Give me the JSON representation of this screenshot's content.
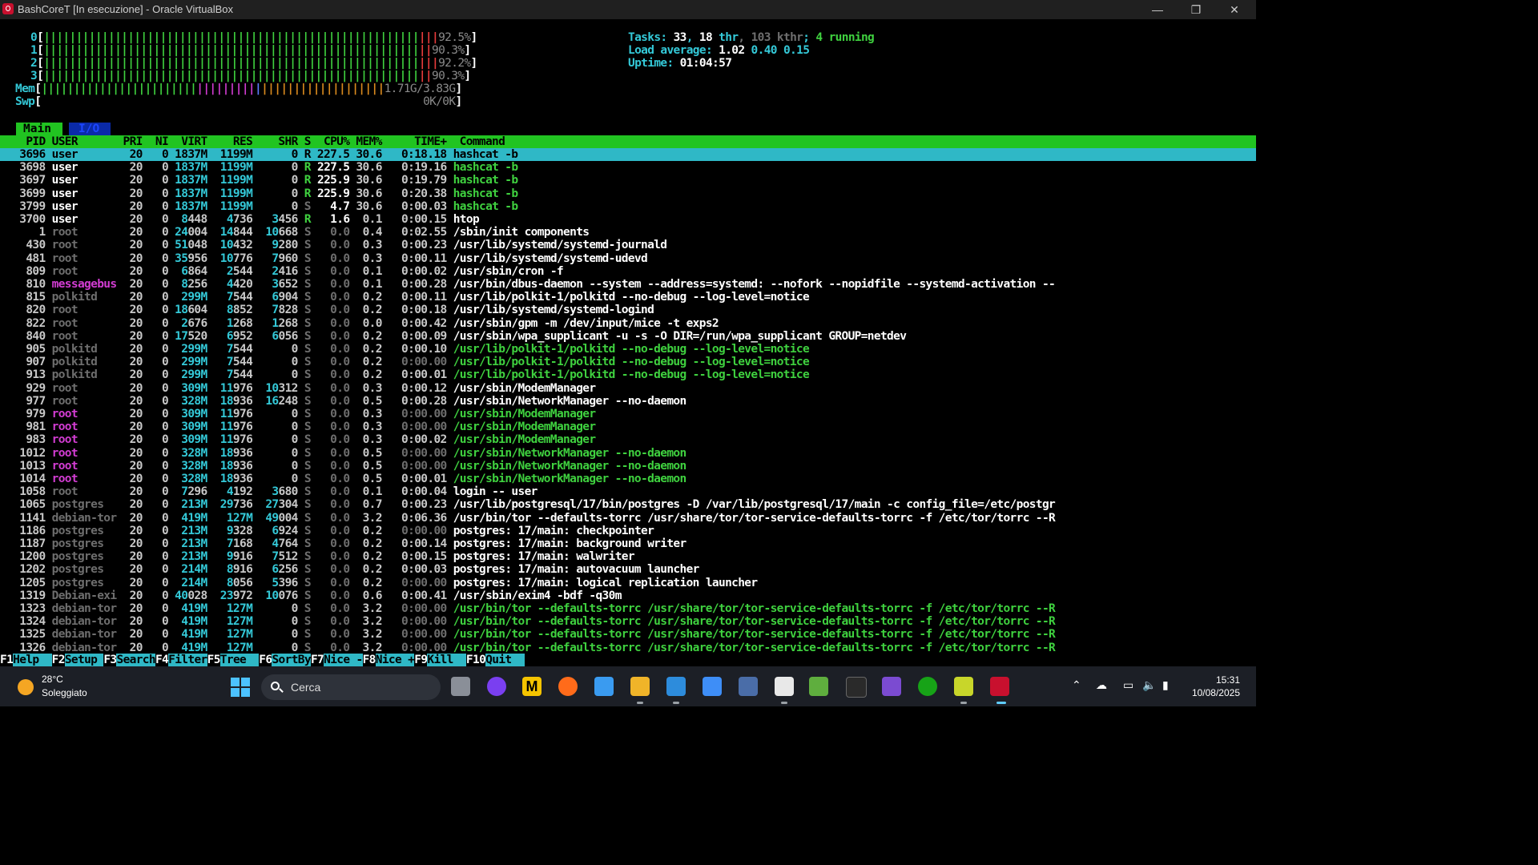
{
  "window": {
    "title": "BashCoreT [In esecuzione] - Oracle VirtualBox",
    "min": "—",
    "max": "❐",
    "close": "✕"
  },
  "meters": {
    "cpu0": "92.5%",
    "cpu1": "90.3%",
    "cpu2": "92.2%",
    "cpu3": "90.3%",
    "mem": "1.71G/3.83G",
    "swp": "0K/0K"
  },
  "stats": {
    "tasks_label": "Tasks: ",
    "tasks": "33",
    "thr": "18",
    "thr_label": " thr",
    "kthr": "103",
    "kthr_label": " kthr",
    "running": "4",
    "running_label": " running",
    "load_label": "Load average: ",
    "load1": "1.02",
    "load5": "0.40",
    "load15": "0.15",
    "uptime_label": "Uptime: ",
    "uptime": "01:04:57"
  },
  "tabs": {
    "main": "Main",
    "io": "I/O"
  },
  "columns": {
    "pid": "PID",
    "user": "USER",
    "pri": "PRI",
    "ni": "NI",
    "virt": "VIRT",
    "res": "RES",
    "shr": "SHR",
    "s": "S",
    "cpu": "CPU%",
    "mem": "MEM%",
    "time": "TIME+",
    "command": "Command"
  },
  "processes": [
    [
      "3696",
      "user",
      "20",
      "0",
      "1837M",
      "1199M",
      "0",
      "R",
      "227.5",
      "30.6",
      "0:18.18",
      "hashcat -b"
    ],
    [
      "3698",
      "user",
      "20",
      "0",
      "1837M",
      "1199M",
      "0",
      "R",
      "227.5",
      "30.6",
      "0:19.16",
      "hashcat -b"
    ],
    [
      "3697",
      "user",
      "20",
      "0",
      "1837M",
      "1199M",
      "0",
      "R",
      "225.9",
      "30.6",
      "0:19.79",
      "hashcat -b"
    ],
    [
      "3699",
      "user",
      "20",
      "0",
      "1837M",
      "1199M",
      "0",
      "R",
      "225.9",
      "30.6",
      "0:20.38",
      "hashcat -b"
    ],
    [
      "3799",
      "user",
      "20",
      "0",
      "1837M",
      "1199M",
      "0",
      "S",
      "4.7",
      "30.6",
      "0:00.03",
      "hashcat -b"
    ],
    [
      "3700",
      "user",
      "20",
      "0",
      "8448",
      "4736",
      "3456",
      "R",
      "1.6",
      "0.1",
      "0:00.15",
      "htop"
    ],
    [
      "1",
      "root",
      "20",
      "0",
      "24004",
      "14844",
      "10668",
      "S",
      "0.0",
      "0.4",
      "0:02.55",
      "/sbin/init components"
    ],
    [
      "430",
      "root",
      "20",
      "0",
      "51048",
      "10432",
      "9280",
      "S",
      "0.0",
      "0.3",
      "0:00.23",
      "/usr/lib/systemd/systemd-journald"
    ],
    [
      "481",
      "root",
      "20",
      "0",
      "35956",
      "10776",
      "7960",
      "S",
      "0.0",
      "0.3",
      "0:00.11",
      "/usr/lib/systemd/systemd-udevd"
    ],
    [
      "809",
      "root",
      "20",
      "0",
      "6864",
      "2544",
      "2416",
      "S",
      "0.0",
      "0.1",
      "0:00.02",
      "/usr/sbin/cron -f"
    ],
    [
      "810",
      "messagebus",
      "20",
      "0",
      "8256",
      "4420",
      "3652",
      "S",
      "0.0",
      "0.1",
      "0:00.28",
      "/usr/bin/dbus-daemon --system --address=systemd: --nofork --nopidfile --systemd-activation --"
    ],
    [
      "815",
      "polkitd",
      "20",
      "0",
      "299M",
      "7544",
      "6904",
      "S",
      "0.0",
      "0.2",
      "0:00.11",
      "/usr/lib/polkit-1/polkitd --no-debug --log-level=notice"
    ],
    [
      "820",
      "root",
      "20",
      "0",
      "18604",
      "8852",
      "7828",
      "S",
      "0.0",
      "0.2",
      "0:00.18",
      "/usr/lib/systemd/systemd-logind"
    ],
    [
      "822",
      "root",
      "20",
      "0",
      "2676",
      "1268",
      "1268",
      "S",
      "0.0",
      "0.0",
      "0:00.42",
      "/usr/sbin/gpm -m /dev/input/mice -t exps2"
    ],
    [
      "840",
      "root",
      "20",
      "0",
      "17520",
      "6952",
      "6056",
      "S",
      "0.0",
      "0.2",
      "0:00.09",
      "/usr/sbin/wpa_supplicant -u -s -O DIR=/run/wpa_supplicant GROUP=netdev"
    ],
    [
      "905",
      "polkitd",
      "20",
      "0",
      "299M",
      "7544",
      "0",
      "S",
      "0.0",
      "0.2",
      "0:00.10",
      "/usr/lib/polkit-1/polkitd --no-debug --log-level=notice"
    ],
    [
      "907",
      "polkitd",
      "20",
      "0",
      "299M",
      "7544",
      "0",
      "S",
      "0.0",
      "0.2",
      "0:00.00",
      "/usr/lib/polkit-1/polkitd --no-debug --log-level=notice"
    ],
    [
      "913",
      "polkitd",
      "20",
      "0",
      "299M",
      "7544",
      "0",
      "S",
      "0.0",
      "0.2",
      "0:00.01",
      "/usr/lib/polkit-1/polkitd --no-debug --log-level=notice"
    ],
    [
      "929",
      "root",
      "20",
      "0",
      "309M",
      "11976",
      "10312",
      "S",
      "0.0",
      "0.3",
      "0:00.12",
      "/usr/sbin/ModemManager"
    ],
    [
      "977",
      "root",
      "20",
      "0",
      "328M",
      "18936",
      "16248",
      "S",
      "0.0",
      "0.5",
      "0:00.28",
      "/usr/sbin/NetworkManager --no-daemon"
    ],
    [
      "979",
      "root",
      "20",
      "0",
      "309M",
      "11976",
      "0",
      "S",
      "0.0",
      "0.3",
      "0:00.00",
      "/usr/sbin/ModemManager"
    ],
    [
      "981",
      "root",
      "20",
      "0",
      "309M",
      "11976",
      "0",
      "S",
      "0.0",
      "0.3",
      "0:00.00",
      "/usr/sbin/ModemManager"
    ],
    [
      "983",
      "root",
      "20",
      "0",
      "309M",
      "11976",
      "0",
      "S",
      "0.0",
      "0.3",
      "0:00.02",
      "/usr/sbin/ModemManager"
    ],
    [
      "1012",
      "root",
      "20",
      "0",
      "328M",
      "18936",
      "0",
      "S",
      "0.0",
      "0.5",
      "0:00.00",
      "/usr/sbin/NetworkManager --no-daemon"
    ],
    [
      "1013",
      "root",
      "20",
      "0",
      "328M",
      "18936",
      "0",
      "S",
      "0.0",
      "0.5",
      "0:00.00",
      "/usr/sbin/NetworkManager --no-daemon"
    ],
    [
      "1014",
      "root",
      "20",
      "0",
      "328M",
      "18936",
      "0",
      "S",
      "0.0",
      "0.5",
      "0:00.01",
      "/usr/sbin/NetworkManager --no-daemon"
    ],
    [
      "1058",
      "root",
      "20",
      "0",
      "7296",
      "4192",
      "3680",
      "S",
      "0.0",
      "0.1",
      "0:00.04",
      "login -- user"
    ],
    [
      "1065",
      "postgres",
      "20",
      "0",
      "213M",
      "29736",
      "27304",
      "S",
      "0.0",
      "0.7",
      "0:00.23",
      "/usr/lib/postgresql/17/bin/postgres -D /var/lib/postgresql/17/main -c config_file=/etc/postgr"
    ],
    [
      "1141",
      "debian-tor",
      "20",
      "0",
      "419M",
      "127M",
      "49004",
      "S",
      "0.0",
      "3.2",
      "0:06.36",
      "/usr/bin/tor --defaults-torrc /usr/share/tor/tor-service-defaults-torrc -f /etc/tor/torrc --R"
    ],
    [
      "1186",
      "postgres",
      "20",
      "0",
      "213M",
      "9328",
      "6924",
      "S",
      "0.0",
      "0.2",
      "0:00.00",
      "postgres: 17/main: checkpointer"
    ],
    [
      "1187",
      "postgres",
      "20",
      "0",
      "213M",
      "7168",
      "4764",
      "S",
      "0.0",
      "0.2",
      "0:00.14",
      "postgres: 17/main: background writer"
    ],
    [
      "1200",
      "postgres",
      "20",
      "0",
      "213M",
      "9916",
      "7512",
      "S",
      "0.0",
      "0.2",
      "0:00.15",
      "postgres: 17/main: walwriter"
    ],
    [
      "1202",
      "postgres",
      "20",
      "0",
      "214M",
      "8916",
      "6256",
      "S",
      "0.0",
      "0.2",
      "0:00.03",
      "postgres: 17/main: autovacuum launcher"
    ],
    [
      "1205",
      "postgres",
      "20",
      "0",
      "214M",
      "8056",
      "5396",
      "S",
      "0.0",
      "0.2",
      "0:00.00",
      "postgres: 17/main: logical replication launcher"
    ],
    [
      "1319",
      "Debian-exi",
      "20",
      "0",
      "40028",
      "23972",
      "10076",
      "S",
      "0.0",
      "0.6",
      "0:00.41",
      "/usr/sbin/exim4 -bdf -q30m"
    ],
    [
      "1323",
      "debian-tor",
      "20",
      "0",
      "419M",
      "127M",
      "0",
      "S",
      "0.0",
      "3.2",
      "0:00.00",
      "/usr/bin/tor --defaults-torrc /usr/share/tor/tor-service-defaults-torrc -f /etc/tor/torrc --R"
    ],
    [
      "1324",
      "debian-tor",
      "20",
      "0",
      "419M",
      "127M",
      "0",
      "S",
      "0.0",
      "3.2",
      "0:00.00",
      "/usr/bin/tor --defaults-torrc /usr/share/tor/tor-service-defaults-torrc -f /etc/tor/torrc --R"
    ],
    [
      "1325",
      "debian-tor",
      "20",
      "0",
      "419M",
      "127M",
      "0",
      "S",
      "0.0",
      "3.2",
      "0:00.00",
      "/usr/bin/tor --defaults-torrc /usr/share/tor/tor-service-defaults-torrc -f /etc/tor/torrc --R"
    ],
    [
      "1326",
      "debian-tor",
      "20",
      "0",
      "419M",
      "127M",
      "0",
      "S",
      "0.0",
      "3.2",
      "0:00.00",
      "/usr/bin/tor --defaults-torrc /usr/share/tor/tor-service-defaults-torrc -f /etc/tor/torrc --R"
    ]
  ],
  "thread_pids": [
    "3698",
    "3697",
    "3699",
    "3799",
    "905",
    "907",
    "913",
    "979",
    "981",
    "983",
    "1012",
    "1013",
    "1014",
    "1323",
    "1324",
    "1325",
    "1326"
  ],
  "fkeys": [
    {
      "key": "F1",
      "label": "Help  "
    },
    {
      "key": "F2",
      "label": "Setup "
    },
    {
      "key": "F3",
      "label": "Search"
    },
    {
      "key": "F4",
      "label": "Filter"
    },
    {
      "key": "F5",
      "label": "Tree  "
    },
    {
      "key": "F6",
      "label": "SortBy"
    },
    {
      "key": "F7",
      "label": "Nice -"
    },
    {
      "key": "F8",
      "label": "Nice +"
    },
    {
      "key": "F9",
      "label": "Kill  "
    },
    {
      "key": "F10",
      "label": "Quit  "
    }
  ],
  "taskbar": {
    "temp": "28°C",
    "weather": "Soleggiato",
    "search": "Cerca",
    "time": "15:31",
    "date": "10/08/2025"
  },
  "colors": {
    "green": "#3fd13f",
    "cyan": "#2fb8c6",
    "red": "#e83b3b",
    "magenta": "#d23cd2",
    "orange": "#d98a1e",
    "blue": "#5d7cff"
  }
}
